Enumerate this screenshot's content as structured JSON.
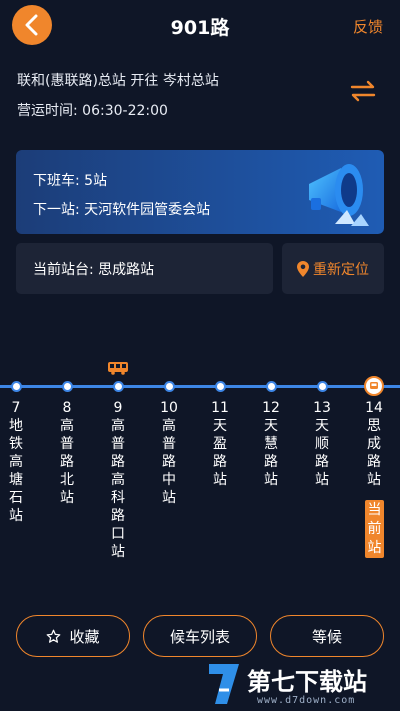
{
  "header": {
    "title": "901路",
    "feedback_label": "反馈"
  },
  "route": {
    "direction": "联和(惠联路)总站 开往 岑村总站",
    "hours": "营运时间: 06:30-22:00"
  },
  "next_bus": {
    "after_work": "下班车: 5站",
    "next_stop": "下一站: 天河软件园管委会站"
  },
  "current_station": {
    "label": "当前站台: 思成路站",
    "relocate_label": "重新定位"
  },
  "stops": [
    {
      "num": "7",
      "name": "地铁高塘石站"
    },
    {
      "num": "8",
      "name": "高普路北站"
    },
    {
      "num": "9",
      "name": "高普路高科路口站"
    },
    {
      "num": "10",
      "name": "高普路中站"
    },
    {
      "num": "11",
      "name": "天盈路站"
    },
    {
      "num": "12",
      "name": "天慧路站"
    },
    {
      "num": "13",
      "name": "天顺路站"
    },
    {
      "num": "14",
      "name": "思成路站"
    }
  ],
  "current_tag": "当前站",
  "actions": {
    "favorite": "收藏",
    "schedule": "候车列表",
    "wait": "等候"
  },
  "watermark": {
    "text": "第七下载站",
    "url": "www.d7down.com"
  },
  "colors": {
    "accent": "#f0862c",
    "line": "#3d86e6",
    "background": "#0f1627",
    "card": "#1d2436"
  }
}
